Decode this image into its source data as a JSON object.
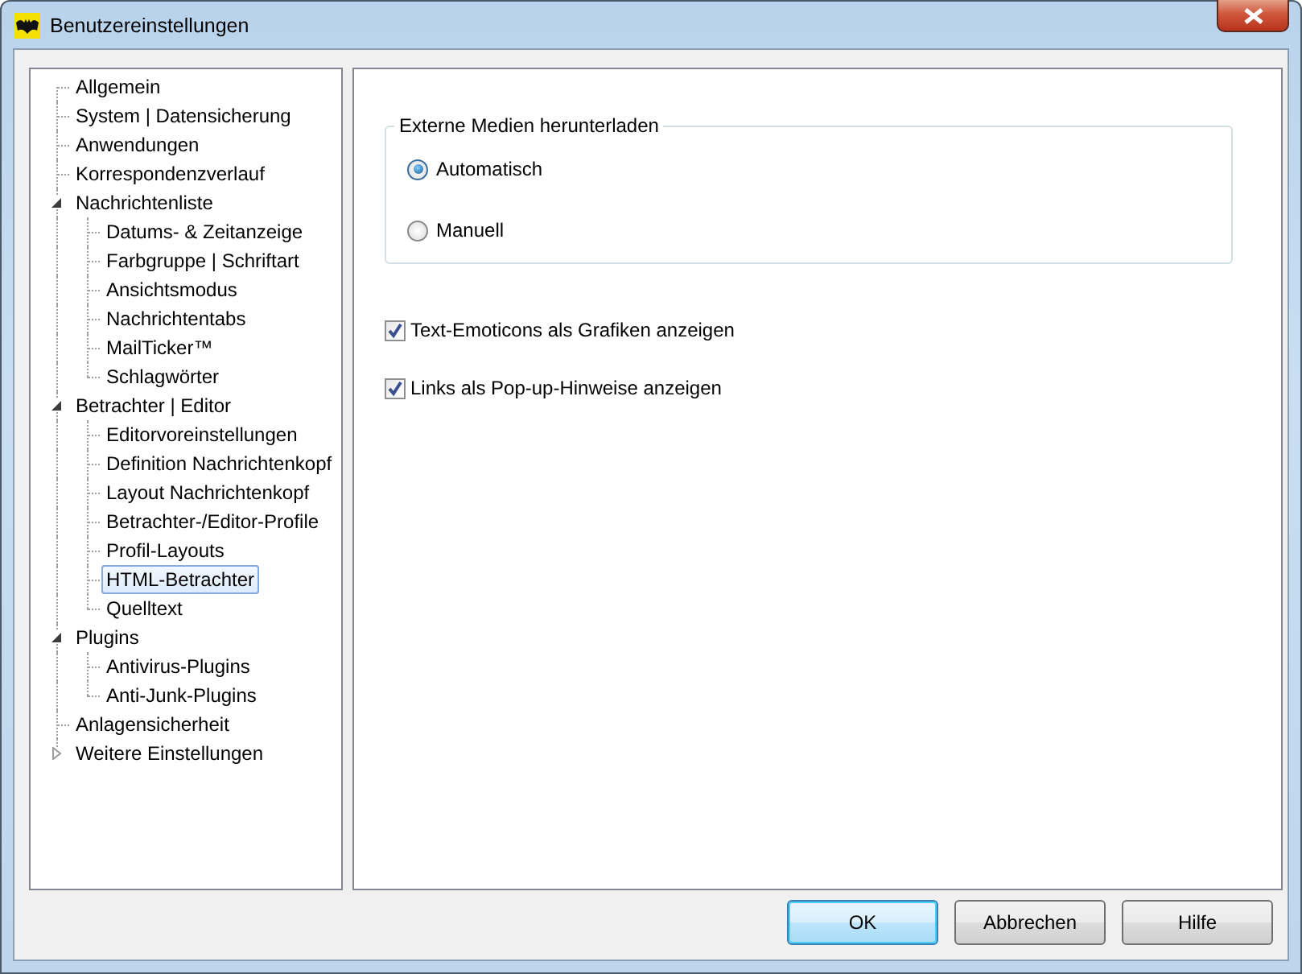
{
  "window": {
    "title": "Benutzereinstellungen"
  },
  "tree": [
    {
      "label": "Allgemein",
      "selected": false
    },
    {
      "label": "System | Datensicherung",
      "selected": false
    },
    {
      "label": "Anwendungen",
      "selected": false
    },
    {
      "label": "Korrespondenzverlauf",
      "selected": false
    },
    {
      "label": "Nachrichtenliste",
      "selected": false,
      "expanded": true,
      "children": [
        {
          "label": "Datums- & Zeitanzeige",
          "selected": false
        },
        {
          "label": "Farbgruppe | Schriftart",
          "selected": false
        },
        {
          "label": "Ansichtsmodus",
          "selected": false
        },
        {
          "label": "Nachrichtentabs",
          "selected": false
        },
        {
          "label": "MailTicker™",
          "selected": false
        },
        {
          "label": "Schlagwörter",
          "selected": false
        }
      ]
    },
    {
      "label": "Betrachter | Editor",
      "selected": false,
      "expanded": true,
      "children": [
        {
          "label": "Editorvoreinstellungen",
          "selected": false
        },
        {
          "label": "Definition Nachrichtenkopf",
          "selected": false
        },
        {
          "label": "Layout Nachrichtenkopf",
          "selected": false
        },
        {
          "label": "Betrachter-/Editor-Profile",
          "selected": false
        },
        {
          "label": "Profil-Layouts",
          "selected": false
        },
        {
          "label": "HTML-Betrachter",
          "selected": true
        },
        {
          "label": "Quelltext",
          "selected": false
        }
      ]
    },
    {
      "label": "Plugins",
      "selected": false,
      "expanded": true,
      "children": [
        {
          "label": "Antivirus-Plugins",
          "selected": false
        },
        {
          "label": "Anti-Junk-Plugins",
          "selected": false
        }
      ]
    },
    {
      "label": "Anlagensicherheit",
      "selected": false
    },
    {
      "label": "Weitere Einstellungen",
      "selected": false,
      "expanded": false
    }
  ],
  "group": {
    "title": "Externe Medien herunterladen",
    "options": [
      {
        "label": "Automatisch",
        "selected": true
      },
      {
        "label": "Manuell",
        "selected": false
      }
    ]
  },
  "checkboxes": [
    {
      "label": "Text-Emoticons als Grafiken anzeigen",
      "checked": true
    },
    {
      "label": "Links als Pop-up-Hinweise anzeigen",
      "checked": true
    }
  ],
  "buttons": [
    {
      "label": "OK",
      "default": true
    },
    {
      "label": "Abbrechen",
      "default": false
    },
    {
      "label": "Hilfe",
      "default": false
    }
  ]
}
